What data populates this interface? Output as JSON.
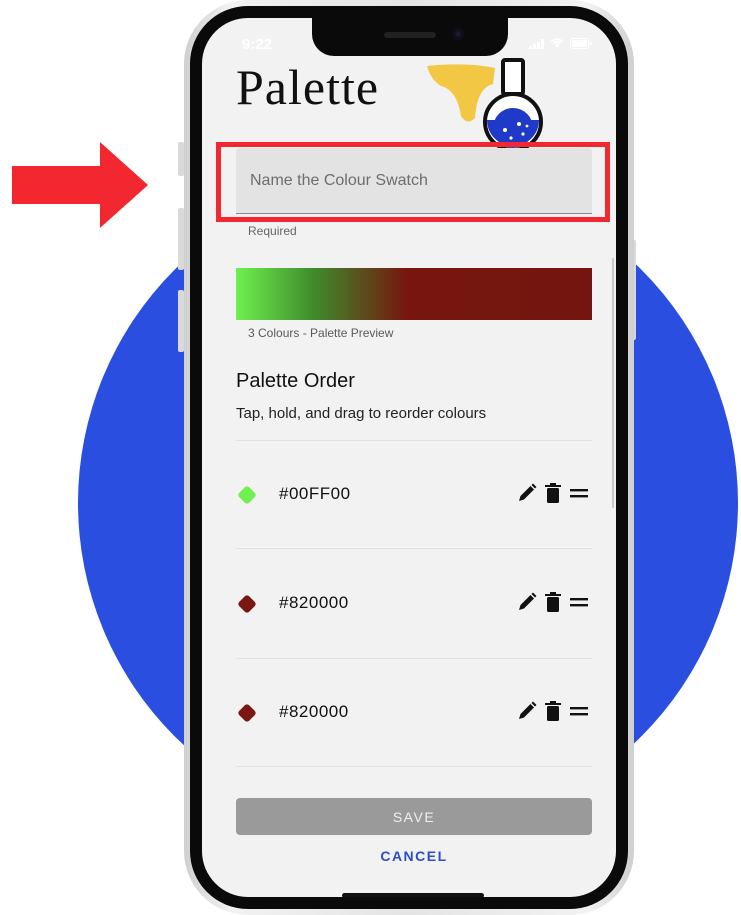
{
  "status_bar": {
    "time": "9:22"
  },
  "header": {
    "title": "Palette",
    "art_icon": "flask-icon"
  },
  "name_field": {
    "placeholder": "Name the Colour Swatch",
    "value": "",
    "helper": "Required"
  },
  "preview": {
    "caption": "3 Colours - Palette Preview",
    "gradient": [
      "#00FF00",
      "#820000",
      "#820000"
    ]
  },
  "order": {
    "heading": "Palette Order",
    "instructions": "Tap, hold, and drag to reorder colours",
    "rows": [
      {
        "hex": "#00FF00",
        "swatch_color": "#6ff04f"
      },
      {
        "hex": "#820000",
        "swatch_color": "#7a1712"
      },
      {
        "hex": "#820000",
        "swatch_color": "#7a1712"
      }
    ],
    "row_icons": [
      "pencil-icon",
      "trash-icon",
      "drag-handle-icon"
    ]
  },
  "actions": {
    "save_label": "SAVE",
    "cancel_label": "CANCEL"
  },
  "colors": {
    "background_circle": "#2a4fe0",
    "highlight": "#f2272f",
    "arrow": "#f2272f",
    "accent": "#2d4ec9",
    "save_disabled": "#9a9a9a"
  }
}
